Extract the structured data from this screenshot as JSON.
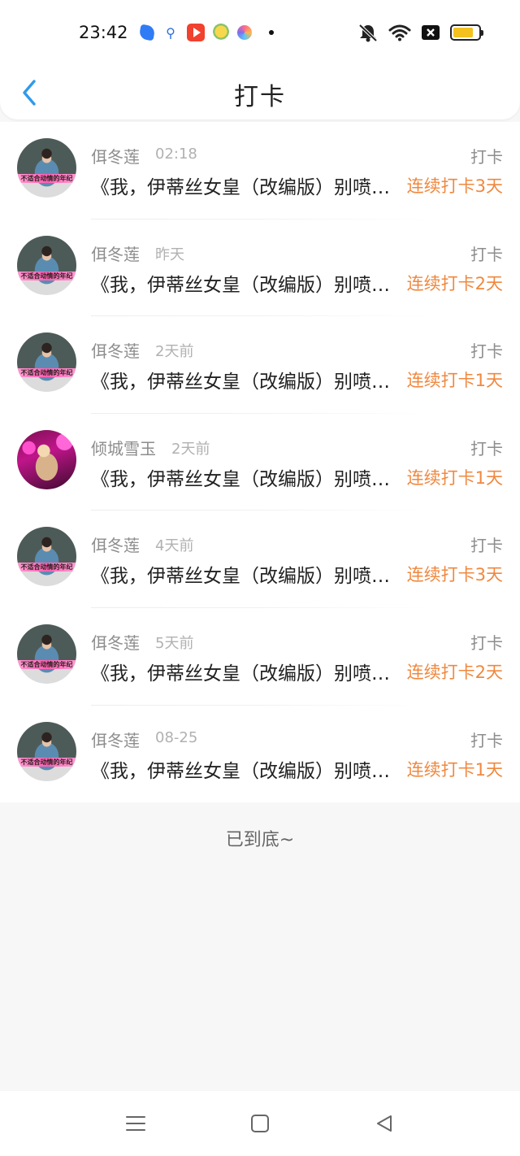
{
  "status_bar": {
    "time": "23:42",
    "notification_icons": [
      "browser-icon",
      "search-icon",
      "video-icon",
      "cartoon-app-icon",
      "flower-app-icon"
    ],
    "system_icons": [
      "mute-bell-icon",
      "wifi-icon",
      "x-icon",
      "battery-icon"
    ],
    "battery_level": 0.8,
    "battery_color": "#f4c21f"
  },
  "header": {
    "title": "打卡",
    "back_icon": "chevron-left-icon",
    "accent_color": "#2f9bea"
  },
  "list": {
    "items": [
      {
        "name": "佴冬莲",
        "time": "02:18",
        "tag": "打卡",
        "book": "《我，伊蒂丝女皇（改编版）别喷…",
        "streak": "连续打卡3天",
        "avatar": "a"
      },
      {
        "name": "佴冬莲",
        "time": "昨天",
        "tag": "打卡",
        "book": "《我，伊蒂丝女皇（改编版）别喷…",
        "streak": "连续打卡2天",
        "avatar": "a"
      },
      {
        "name": "佴冬莲",
        "time": "2天前",
        "tag": "打卡",
        "book": "《我，伊蒂丝女皇（改编版）别喷…",
        "streak": "连续打卡1天",
        "avatar": "a"
      },
      {
        "name": "倾城雪玉",
        "time": "2天前",
        "tag": "打卡",
        "book": "《我，伊蒂丝女皇（改编版）别喷…",
        "streak": "连续打卡1天",
        "avatar": "b"
      },
      {
        "name": "佴冬莲",
        "time": "4天前",
        "tag": "打卡",
        "book": "《我，伊蒂丝女皇（改编版）别喷…",
        "streak": "连续打卡3天",
        "avatar": "a"
      },
      {
        "name": "佴冬莲",
        "time": "5天前",
        "tag": "打卡",
        "book": "《我，伊蒂丝女皇（改编版）别喷…",
        "streak": "连续打卡2天",
        "avatar": "a"
      },
      {
        "name": "佴冬莲",
        "time": "08-25",
        "tag": "打卡",
        "book": "《我，伊蒂丝女皇（改编版）别喷…",
        "streak": "连续打卡1天",
        "avatar": "a"
      }
    ],
    "avatar_caption": "不适合动情的年纪",
    "streak_color": "#f0883f"
  },
  "footer": {
    "end_text": "已到底~"
  },
  "nav_bar": {
    "buttons": [
      "menu-icon",
      "home-square-icon",
      "back-triangle-icon"
    ]
  }
}
